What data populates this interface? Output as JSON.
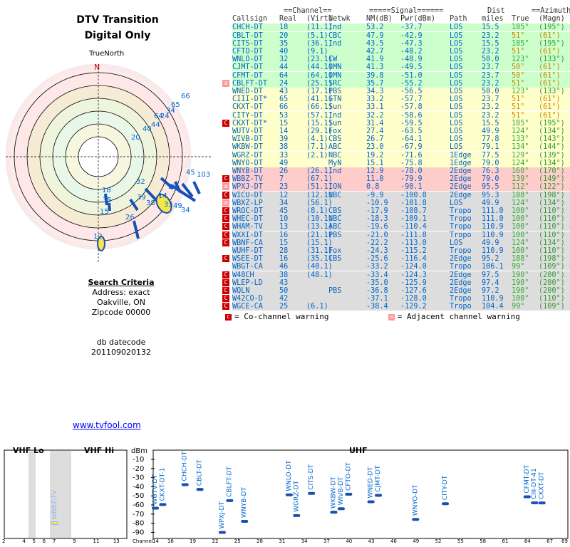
{
  "header": {
    "title_line1": "DTV Transition",
    "title_line2": "Digital Only",
    "true_north": "TrueNorth",
    "compass_n": "N"
  },
  "criteria": {
    "heading": "Search Criteria",
    "address": "Address: exact",
    "city": "Oakville, ON",
    "zip": "Zipcode 00000",
    "datecode_label": "db datecode",
    "datecode": "201109020132"
  },
  "link": "www.tvfool.com",
  "colors": {
    "table_blue": "#0066cc",
    "green_rows": "#ccffcc",
    "yellow_rows": "#ffffcc",
    "pink_rows": "#ffcccc",
    "gray_rows": "#dddddd",
    "co_channel": "#cc0000",
    "adjacent": "#ff9999"
  },
  "table": {
    "group_headers": {
      "channel": "Channel",
      "signal": "Signal",
      "dist": "Dist",
      "azimuth": "Azimuth"
    },
    "columns": [
      "Callsign",
      "Real",
      "(Virt)",
      "Netwk",
      "NM(dB)",
      "Pwr(dBm)",
      "Path",
      "miles",
      "True",
      "(Magn)"
    ],
    "rows": [
      [
        "CHCH-DT",
        "18",
        "(11.1)",
        "Ind",
        "53.2",
        "-37.7",
        "LOS",
        "15.5",
        "185°",
        "(195°)",
        "g",
        ""
      ],
      [
        "CBLT-DT",
        "20",
        "(5.1)",
        "CBC",
        "47.9",
        "-42.9",
        "LOS",
        "23.2",
        "51°",
        "(61°)",
        "g",
        ""
      ],
      [
        "CITS-DT",
        "35",
        "(36.1)",
        "Ind",
        "43.5",
        "-47.3",
        "LOS",
        "15.5",
        "185°",
        "(195°)",
        "g",
        ""
      ],
      [
        "CFTO-DT",
        "40",
        "(9.1)",
        "",
        "42.7",
        "-48.2",
        "LOS",
        "23.2",
        "51°",
        "(61°)",
        "g",
        ""
      ],
      [
        "WNLO-DT",
        "32",
        "(23.1)",
        "CW",
        "41.9",
        "-48.9",
        "LOS",
        "50.0",
        "123°",
        "(133°)",
        "g",
        ""
      ],
      [
        "CJMT-DT",
        "44",
        "(44.1)",
        "OMN",
        "41.3",
        "-49.5",
        "LOS",
        "23.7",
        "50°",
        "(61°)",
        "g",
        ""
      ],
      [
        "CFMT-DT",
        "64",
        "(64.1)",
        "OMN",
        "39.8",
        "-51.0",
        "LOS",
        "23.7",
        "50°",
        "(61°)",
        "g",
        ""
      ],
      [
        "CBLFT-DT",
        "24",
        "(25.1)",
        "SRC",
        "35.7",
        "-55.2",
        "LOS",
        "23.2",
        "51°",
        "(61°)",
        "g",
        "a"
      ],
      [
        "WNED-DT",
        "43",
        "(17.1)",
        "PBS",
        "34.3",
        "-56.5",
        "LOS",
        "50.0",
        "123°",
        "(133°)",
        "y",
        ""
      ],
      [
        "CIII-DT*",
        "65",
        "(41.1)",
        "GTN",
        "33.2",
        "-57.7",
        "LOS",
        "23.7",
        "51°",
        "(61°)",
        "y",
        ""
      ],
      [
        "CKXT-DT",
        "66",
        "(66.1)",
        "Sun",
        "33.1",
        "-57.8",
        "LOS",
        "23.2",
        "51°",
        "(61°)",
        "y",
        ""
      ],
      [
        "CITY-DT",
        "53",
        "(57.1)",
        "Ind",
        "32.2",
        "-58.6",
        "LOS",
        "23.2",
        "51°",
        "(61°)",
        "y",
        ""
      ],
      [
        "CKXT-DT*",
        "15",
        "(15.1)",
        "Sun",
        "31.4",
        "-59.5",
        "LOS",
        "15.5",
        "185°",
        "(195°)",
        "y",
        "c"
      ],
      [
        "WUTV-DT",
        "14",
        "(29.1)",
        "Fox",
        "27.4",
        "-63.5",
        "LOS",
        "49.9",
        "124°",
        "(134°)",
        "y",
        ""
      ],
      [
        "WIVB-DT",
        "39",
        "(4.1)",
        "CBS",
        "26.7",
        "-64.1",
        "LOS",
        "77.8",
        "133°",
        "(143°)",
        "y",
        ""
      ],
      [
        "WKBW-DT",
        "38",
        "(7.1)",
        "ABC",
        "23.0",
        "-67.9",
        "LOS",
        "79.1",
        "134°",
        "(144°)",
        "y",
        ""
      ],
      [
        "WGRZ-DT",
        "33",
        "(2.1)",
        "NBC",
        "19.2",
        "-71.6",
        "1Edge",
        "77.5",
        "129°",
        "(139°)",
        "y",
        ""
      ],
      [
        "WNYO-DT",
        "49",
        "",
        "MyN",
        "15.1",
        "-75.8",
        "1Edge",
        "79.0",
        "124°",
        "(134°)",
        "y",
        ""
      ],
      [
        "WNYB-DT",
        "26",
        "(26.1)",
        "Ind",
        "12.9",
        "-78.0",
        "2Edge",
        "76.3",
        "160°",
        "(170°)",
        "p",
        ""
      ],
      [
        "WBBZ-TV",
        "7",
        "(67.1)",
        "",
        "11.0",
        "-79.9",
        "2Edge",
        "79.0",
        "139°",
        "(149°)",
        "p",
        "c"
      ],
      [
        "WPXJ-DT",
        "23",
        "(51.1)",
        "ION",
        "0.8",
        "-90.1",
        "2Edge",
        "95.5",
        "112°",
        "(122°)",
        "p",
        "a"
      ],
      [
        "WICU-DT",
        "12",
        "(12.1)",
        "NBC",
        "-9.9",
        "-100.8",
        "2Edge",
        "95.3",
        "188°",
        "(198°)",
        "x",
        "c"
      ],
      [
        "WBXZ-LP",
        "34",
        "(56.1)",
        "",
        "-10.9",
        "-101.8",
        "LOS",
        "49.9",
        "124°",
        "(134°)",
        "x",
        "a"
      ],
      [
        "WROC-DT",
        "45",
        "(8.1)",
        "CBS",
        "-17.9",
        "-108.7",
        "Tropo",
        "111.0",
        "100°",
        "(110°)",
        "x",
        "c"
      ],
      [
        "WHEC-DT",
        "10",
        "(10.1)",
        "NBC",
        "-18.3",
        "-109.1",
        "Tropo",
        "111.0",
        "100°",
        "(110°)",
        "x",
        "c"
      ],
      [
        "WHAM-TV",
        "13",
        "(13.1)",
        "ABC",
        "-19.6",
        "-110.4",
        "Tropo",
        "110.9",
        "100°",
        "(110°)",
        "x",
        "c"
      ],
      [
        "WXXI-DT",
        "16",
        "(21.1)",
        "PBS",
        "-21.0",
        "-111.8",
        "Tropo",
        "110.9",
        "100°",
        "(110°)",
        "x",
        "c"
      ],
      [
        "WBNF-CA",
        "15",
        "(15.1)",
        "",
        "-22.2",
        "-113.0",
        "LOS",
        "49.9",
        "124°",
        "(134°)",
        "x",
        "c"
      ],
      [
        "WUHF-DT",
        "28",
        "(31.1)",
        "Fox",
        "-24.3",
        "-115.2",
        "Tropo",
        "110.9",
        "100°",
        "(110°)",
        "x",
        ""
      ],
      [
        "WSEE-DT",
        "16",
        "(35.1)",
        "CBS",
        "-25.6",
        "-116.4",
        "2Edge",
        "95.2",
        "188°",
        "(198°)",
        "x",
        "c"
      ],
      [
        "WBGT-CA",
        "46",
        "(40.1)",
        "",
        "-33.2",
        "-124.0",
        "Tropo",
        "106.1",
        "99°",
        "(109°)",
        "x",
        ""
      ],
      [
        "W48CH",
        "38",
        "(48.1)",
        "",
        "-33.4",
        "-124.3",
        "2Edge",
        "97.5",
        "190°",
        "(200°)",
        "x",
        "c"
      ],
      [
        "WLEP-LD",
        "43",
        "",
        "",
        "-35.0",
        "-125.9",
        "2Edge",
        "97.4",
        "190°",
        "(200°)",
        "x",
        "c"
      ],
      [
        "WQLN",
        "50",
        "",
        "PBS",
        "-36.8",
        "-127.6",
        "2Edge",
        "97.2",
        "190°",
        "(200°)",
        "x",
        "c"
      ],
      [
        "W42CO-D",
        "42",
        "",
        "",
        "-37.1",
        "-128.0",
        "Tropo",
        "110.9",
        "100°",
        "(110°)",
        "x",
        "c"
      ],
      [
        "WGCE-CA",
        "25",
        "(6.1)",
        "",
        "-38.4",
        "-129.2",
        "Tropo",
        "104.4",
        "99°",
        "(109°)",
        "x",
        "c"
      ]
    ]
  },
  "legend": {
    "co_mark": "C",
    "co_text": "= Co-channel warning",
    "adj_mark": "a",
    "adj_text": "= Adjacent channel warning"
  },
  "polar": {
    "labels": [
      "66",
      "65",
      "34",
      "24",
      "64",
      "44",
      "40",
      "20",
      "45",
      "103",
      "23",
      "14",
      "38",
      "39",
      "33",
      "49",
      "34",
      "32",
      "18",
      "35",
      "15",
      "26",
      "12"
    ]
  },
  "spectrum": {
    "vhf_lo": "VHF Lo",
    "vhf_hi": "VHF Hi",
    "uhf": "UHF",
    "unit": "dBm",
    "channel_label": "Channel",
    "y_ticks": [
      "-10",
      "-20",
      "-30",
      "-40",
      "-50",
      "-60",
      "-70",
      "-80",
      "-90"
    ],
    "vhf_ticks": [
      "2",
      "4",
      "5",
      "6",
      "7",
      "9",
      "11",
      "13"
    ],
    "uhf_ticks": [
      "14",
      "16",
      "19",
      "22",
      "25",
      "28",
      "31",
      "34",
      "37",
      "40",
      "43",
      "46",
      "49",
      "52",
      "55",
      "58",
      "61",
      "64",
      "67",
      "69"
    ],
    "stations": [
      {
        "label": "WBBZ-TV",
        "ch": 7,
        "dbm": -79.9,
        "band": "vhf"
      },
      {
        "label": "WUTV-DT",
        "ch": 14,
        "dbm": -63.5,
        "band": "uhf"
      },
      {
        "label": "CKXT-DT-1",
        "ch": 15,
        "dbm": -59.5,
        "band": "uhf"
      },
      {
        "label": "CHCH-DT",
        "ch": 18,
        "dbm": -37.7,
        "band": "uhf"
      },
      {
        "label": "CBLT-DT",
        "ch": 20,
        "dbm": -42.9,
        "band": "uhf"
      },
      {
        "label": "WPXJ-DT",
        "ch": 23,
        "dbm": -90.1,
        "band": "uhf"
      },
      {
        "label": "CBLFT-DT",
        "ch": 24,
        "dbm": -55.2,
        "band": "uhf"
      },
      {
        "label": "WNYB-DT",
        "ch": 26,
        "dbm": -78.0,
        "band": "uhf"
      },
      {
        "label": "WNLO-DT",
        "ch": 32,
        "dbm": -48.9,
        "band": "uhf"
      },
      {
        "label": "WGRZ-DT",
        "ch": 33,
        "dbm": -71.6,
        "band": "uhf"
      },
      {
        "label": "CITS-DT",
        "ch": 35,
        "dbm": -47.3,
        "band": "uhf"
      },
      {
        "label": "WKBW-DT",
        "ch": 38,
        "dbm": -67.9,
        "band": "uhf"
      },
      {
        "label": "WIVB-DT",
        "ch": 39,
        "dbm": -64.1,
        "band": "uhf"
      },
      {
        "label": "CFTO-DT",
        "ch": 40,
        "dbm": -48.2,
        "band": "uhf"
      },
      {
        "label": "WNED-DT",
        "ch": 43,
        "dbm": -56.5,
        "band": "uhf"
      },
      {
        "label": "CJMT-DT",
        "ch": 44,
        "dbm": -49.5,
        "band": "uhf"
      },
      {
        "label": "WNYO-DT",
        "ch": 49,
        "dbm": -75.8,
        "band": "uhf"
      },
      {
        "label": "CITY-DT",
        "ch": 53,
        "dbm": -58.6,
        "band": "uhf"
      },
      {
        "label": "CFMT-DT",
        "ch": 64,
        "dbm": -51.0,
        "band": "uhf"
      },
      {
        "label": "CIII-DT-41",
        "ch": 65,
        "dbm": -57.7,
        "band": "uhf"
      },
      {
        "label": "CKXT-DT",
        "ch": 66,
        "dbm": -57.8,
        "band": "uhf"
      }
    ]
  }
}
